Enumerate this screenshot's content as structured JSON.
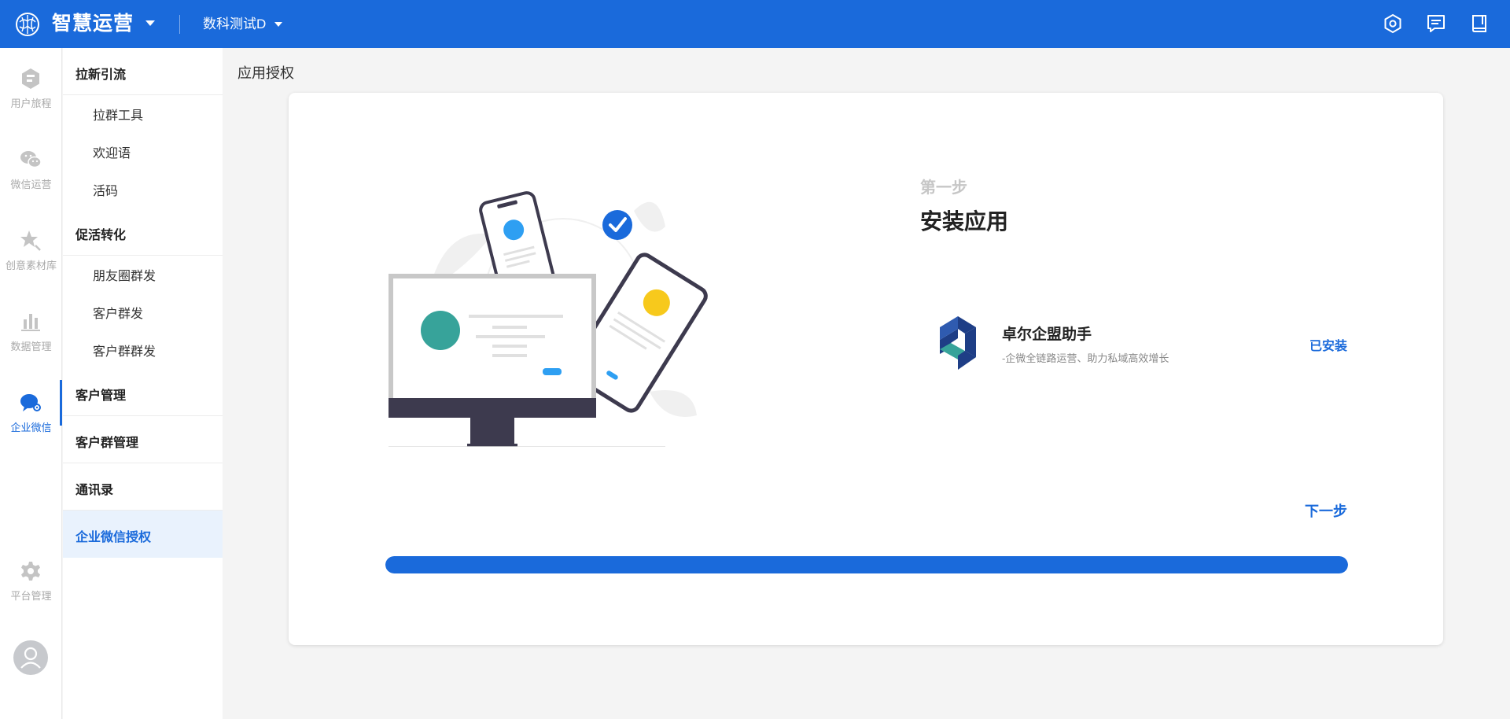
{
  "header": {
    "brand": "智慧运营",
    "workspace": "数科测试D",
    "icons": [
      "settings-hex-icon",
      "message-icon",
      "book-icon"
    ]
  },
  "rail": {
    "items": [
      {
        "label": "用户旅程",
        "icon": "journey-icon",
        "active": false
      },
      {
        "label": "微信运营",
        "icon": "wechat-icon",
        "active": false
      },
      {
        "label": "创意素材库",
        "icon": "star-icon",
        "active": false
      },
      {
        "label": "数据管理",
        "icon": "bar-chart-icon",
        "active": false
      },
      {
        "label": "企业微信",
        "icon": "wecom-icon",
        "active": true
      },
      {
        "label": "平台管理",
        "icon": "gear-icon",
        "active": false
      }
    ]
  },
  "submenu": {
    "g1": {
      "label": "拉新引流",
      "items": [
        "拉群工具",
        "欢迎语",
        "活码"
      ]
    },
    "g2": {
      "label": "促活转化",
      "items": [
        "朋友圈群发",
        "客户群发",
        "客户群群发"
      ]
    },
    "g3": {
      "label": "客户管理"
    },
    "g4": {
      "label": "客户群管理"
    },
    "g5": {
      "label": "通讯录"
    },
    "g6": {
      "label": "企业微信授权"
    }
  },
  "page": {
    "title": "应用授权",
    "step_no": "第一步",
    "step_title": "安装应用",
    "app": {
      "name": "卓尔企盟助手",
      "desc": "-企微全链路运营、助力私域高效增长",
      "status": "已安装"
    },
    "next_label": "下一步",
    "progress": 1.0
  },
  "colors": {
    "primary": "#1a6adb",
    "teal": "#37a39a",
    "yellow": "#f7c91c",
    "dark": "#3d3a4e"
  }
}
